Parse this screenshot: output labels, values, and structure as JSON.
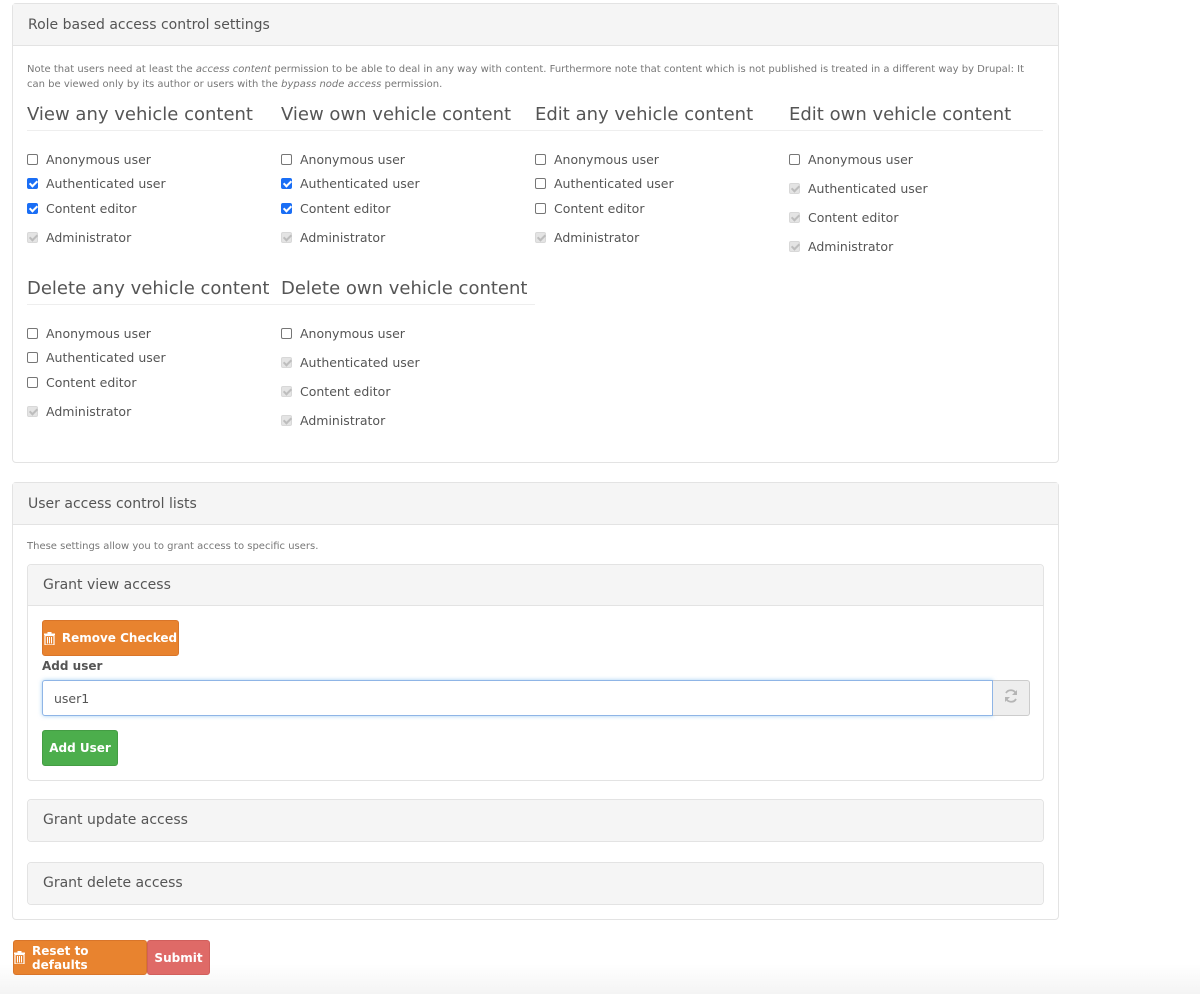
{
  "role_panel": {
    "title": "Role based access control settings",
    "note": {
      "part1": "Note that users need at least the ",
      "em1": "access content",
      "part2": " permission to be able to deal in any way with content. Furthermore note that content which is not published is treated in a different way by Drupal: It can be viewed only by its author or users with the ",
      "em2": "bypass node access",
      "part3": " permission."
    },
    "groups": [
      {
        "title": "View any vehicle content",
        "options": [
          {
            "label": "Anonymous user",
            "state": "unchecked"
          },
          {
            "label": "Authenticated user",
            "state": "checked"
          },
          {
            "label": "Content editor",
            "state": "checked"
          },
          {
            "label": "Administrator",
            "state": "disabled-checked"
          }
        ]
      },
      {
        "title": "View own vehicle content",
        "options": [
          {
            "label": "Anonymous user",
            "state": "unchecked"
          },
          {
            "label": "Authenticated user",
            "state": "checked"
          },
          {
            "label": "Content editor",
            "state": "checked"
          },
          {
            "label": "Administrator",
            "state": "disabled-checked"
          }
        ]
      },
      {
        "title": "Edit any vehicle content",
        "options": [
          {
            "label": "Anonymous user",
            "state": "unchecked"
          },
          {
            "label": "Authenticated user",
            "state": "unchecked"
          },
          {
            "label": "Content editor",
            "state": "unchecked"
          },
          {
            "label": "Administrator",
            "state": "disabled-checked"
          }
        ]
      },
      {
        "title": "Edit own vehicle content",
        "options": [
          {
            "label": "Anonymous user",
            "state": "unchecked"
          },
          {
            "label": "Authenticated user",
            "state": "disabled-checked"
          },
          {
            "label": "Content editor",
            "state": "disabled-checked"
          },
          {
            "label": "Administrator",
            "state": "disabled-checked"
          }
        ]
      },
      {
        "title": "Delete any vehicle content",
        "options": [
          {
            "label": "Anonymous user",
            "state": "unchecked"
          },
          {
            "label": "Authenticated user",
            "state": "unchecked"
          },
          {
            "label": "Content editor",
            "state": "unchecked"
          },
          {
            "label": "Administrator",
            "state": "disabled-checked"
          }
        ]
      },
      {
        "title": "Delete own vehicle content",
        "options": [
          {
            "label": "Anonymous user",
            "state": "unchecked"
          },
          {
            "label": "Authenticated user",
            "state": "disabled-checked"
          },
          {
            "label": "Content editor",
            "state": "disabled-checked"
          },
          {
            "label": "Administrator",
            "state": "disabled-checked"
          }
        ]
      }
    ]
  },
  "user_panel": {
    "title": "User access control lists",
    "note": "These settings allow you to grant access to specific users.",
    "grant_view": {
      "title": "Grant view access",
      "remove_checked_label": "Remove Checked",
      "add_user_label": "Add user",
      "add_user_value": "user1",
      "add_user_button": "Add User"
    },
    "grant_update": {
      "title": "Grant update access"
    },
    "grant_delete": {
      "title": "Grant delete access"
    }
  },
  "actions": {
    "reset_label": "Reset to defaults",
    "submit_label": "Submit"
  },
  "colors": {
    "orange": "#e8832f",
    "green": "#4cae4c",
    "red": "#df6a67",
    "checkbox_blue": "#1a6ef5"
  }
}
